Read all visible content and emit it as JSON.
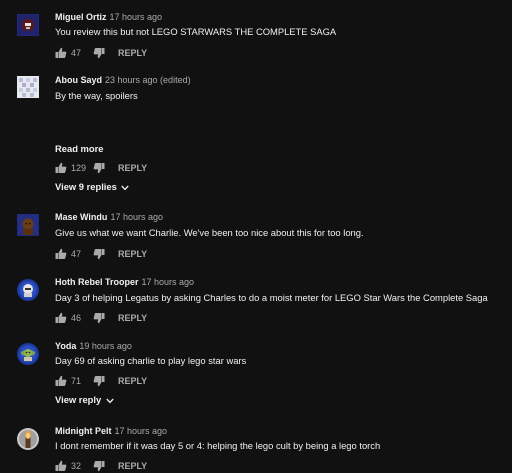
{
  "comments": [
    {
      "author": "Miguel Ortiz",
      "time": "17 hours ago",
      "text": "You review this but not LEGO STARWARS THE COMPLETE SAGA",
      "likes": "47",
      "reply_label": "REPLY",
      "avatar_icon": "stormtrooper-avatar-icon"
    },
    {
      "author": "Abou Sayd",
      "time": "23 hours ago (edited)",
      "text": "By the way, spoilers",
      "read_more_label": "Read more",
      "likes": "129",
      "reply_label": "REPLY",
      "view_replies_label": "View 9 replies",
      "avatar_icon": "pixel-pattern-avatar-icon"
    },
    {
      "author": "Mase Windu",
      "time": "17 hours ago",
      "text": "Give us what we want Charlie. We've been too nice about this for too long.",
      "likes": "47",
      "reply_label": "REPLY",
      "avatar_icon": "lego-figure-avatar-icon"
    },
    {
      "author": "Hoth Rebel Trooper",
      "time": "17 hours ago",
      "text": "Day 3 of helping Legatus by asking Charles to do a moist meter for LEGO Star Wars the Complete Saga",
      "likes": "46",
      "reply_label": "REPLY",
      "avatar_icon": "rebel-trooper-avatar-icon"
    },
    {
      "author": "Yoda",
      "time": "19 hours ago",
      "text": "Day 69 of asking charlie to play lego star wars",
      "likes": "71",
      "reply_label": "REPLY",
      "view_replies_label": "View reply",
      "avatar_icon": "yoda-avatar-icon"
    },
    {
      "author": "Midnight Pelt",
      "time": "17 hours ago",
      "text": "I dont remember if it was day 5 or 4: helping the lego cult by being a lego torch",
      "likes": "32",
      "reply_label": "REPLY",
      "avatar_icon": "lego-torch-avatar-icon"
    }
  ]
}
